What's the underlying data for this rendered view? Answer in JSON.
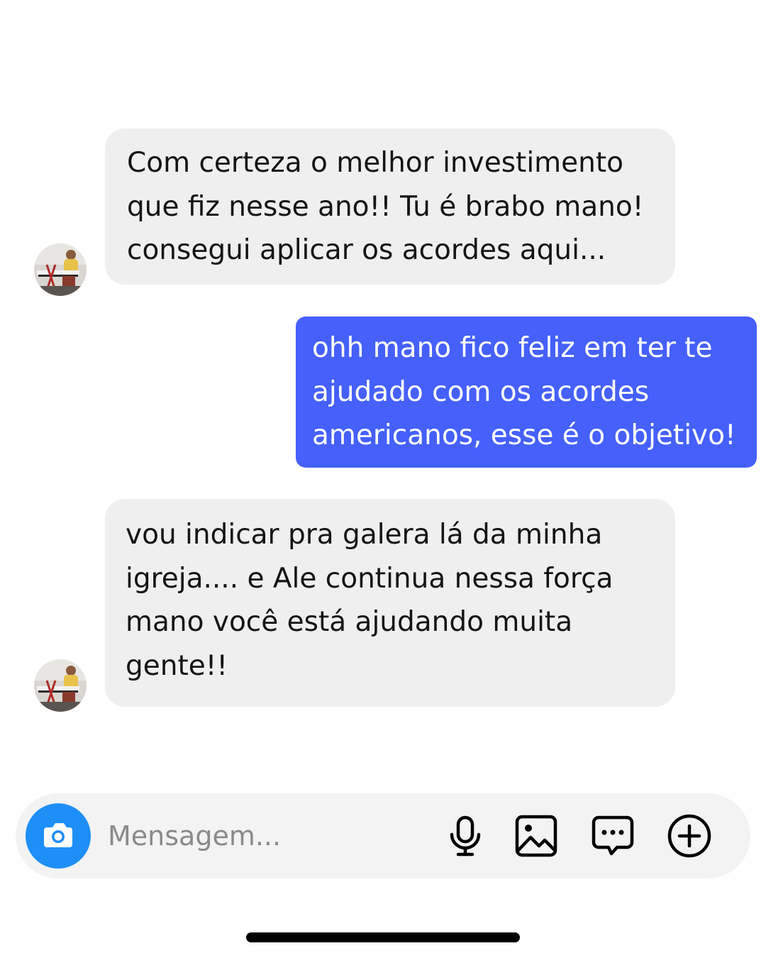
{
  "messages": [
    {
      "from": "contact",
      "lines": [
        "Com certeza o melhor investimento",
        "que fiz nesse ano!! Tu é brabo mano!",
        "consegui aplicar os acordes aqui..."
      ]
    },
    {
      "from": "me",
      "lines": [
        "ohh mano fico feliz em ter te",
        "ajudado com os acordes",
        "americanos, esse é o objetivo!"
      ]
    },
    {
      "from": "contact",
      "lines": [
        "vou indicar pra galera lá da minha",
        "igreja.... e Ale continua nessa força",
        "mano você está ajudando muita",
        "gente!!"
      ]
    }
  ],
  "composer": {
    "placeholder": "Mensagem...",
    "icons": [
      "camera-icon",
      "microphone-icon",
      "image-icon",
      "sticker-chat-icon",
      "plus-circle-icon"
    ]
  },
  "colors": {
    "incoming_bubble": "#efefef",
    "outgoing_bubble": "#4560fb",
    "camera_button": "#1e8ff7",
    "text": "#141414"
  }
}
